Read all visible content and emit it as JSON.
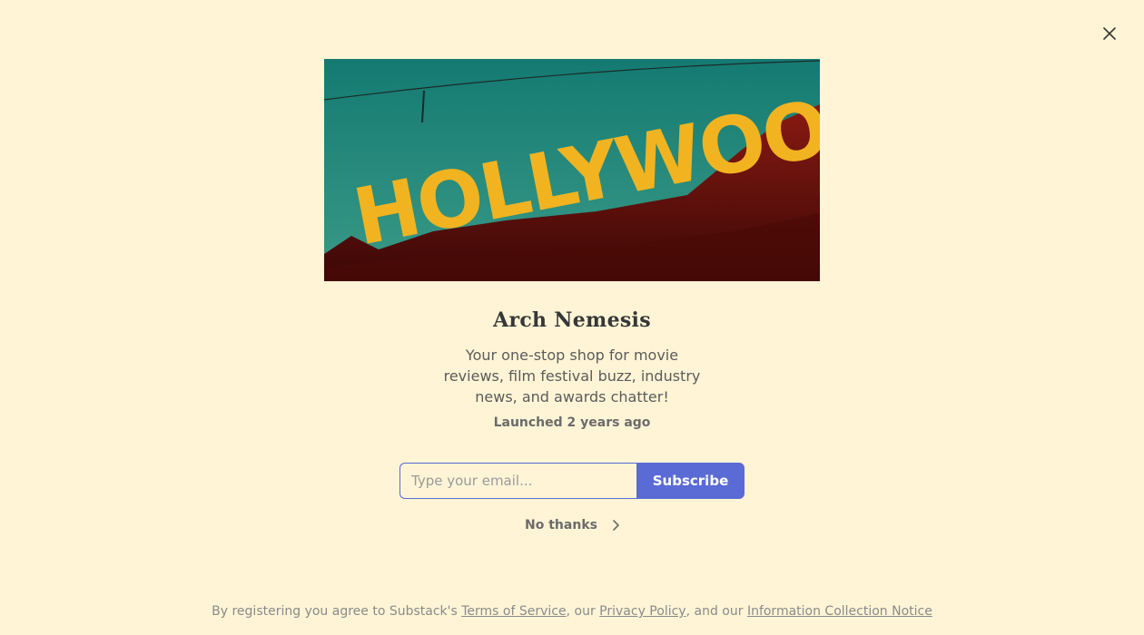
{
  "modal": {
    "close_icon": "close-icon",
    "hero_image": {
      "alt": "Hollywood sign",
      "sign_text": "HOLLYWOOD",
      "colors": {
        "sky": "#1f8a7e",
        "hill": "#7a1410",
        "letters": "#f2b320"
      }
    },
    "title": "Arch Nemesis",
    "description": "Your one-stop shop for movie reviews, film festival buzz, industry news, and awards chatter!",
    "launched": "Launched 2 years ago",
    "form": {
      "email_placeholder": "Type your email...",
      "subscribe_label": "Subscribe"
    },
    "no_thanks_label": "No thanks",
    "no_thanks_icon": "chevron-right-icon"
  },
  "footer": {
    "prefix": "By registering you agree to Substack's ",
    "terms_link": "Terms of Service",
    "sep1": ", our ",
    "privacy_link": "Privacy Policy",
    "sep2": ", and our ",
    "notice_link": "Information Collection Notice"
  },
  "colors": {
    "background": "#fff5d6",
    "accent": "#5a6bd6",
    "title": "#363737"
  }
}
